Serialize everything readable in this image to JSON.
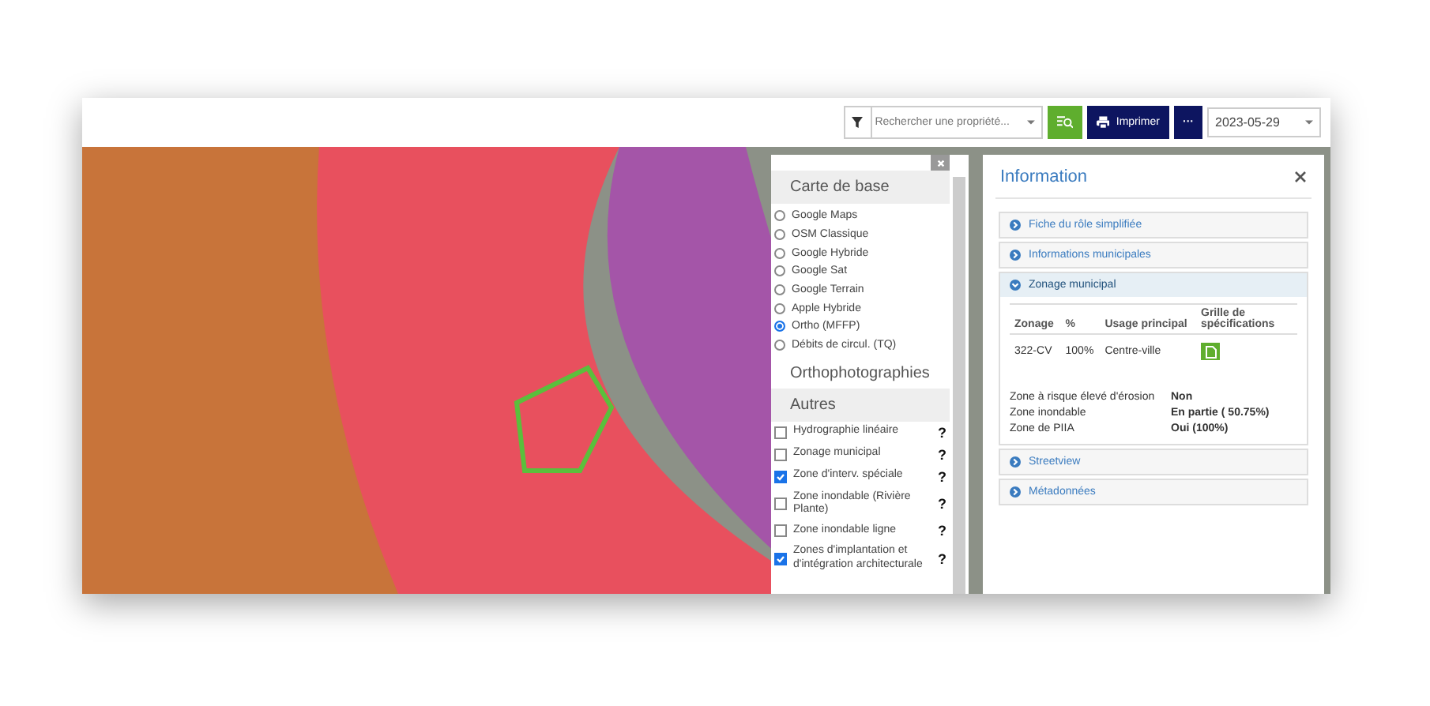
{
  "toolbar": {
    "search": {
      "placeholder": "Rechercher une propriété..."
    },
    "print_button": "Imprimer",
    "more_button": "···",
    "date": {
      "value": "2023-05-29"
    }
  },
  "layers_panel": {
    "base_title": "Carte de base",
    "base_maps": [
      {
        "label": "Google Maps",
        "selected": false
      },
      {
        "label": "OSM Classique",
        "selected": false
      },
      {
        "label": "Google Hybride",
        "selected": false
      },
      {
        "label": "Google Sat",
        "selected": false
      },
      {
        "label": "Google Terrain",
        "selected": false
      },
      {
        "label": "Apple Hybride",
        "selected": false
      },
      {
        "label": "Ortho (MFFP)",
        "selected": true
      },
      {
        "label": "Débits de circul. (TQ)",
        "selected": false
      }
    ],
    "ortho_title": "Orthophotographies",
    "other_title": "Autres",
    "help": "?",
    "layers": [
      {
        "label": "Hydrographie linéaire",
        "checked": false
      },
      {
        "label": "Zonage municipal",
        "checked": false
      },
      {
        "label": "Zone d'interv. spéciale",
        "checked": true
      },
      {
        "label": "Zone inondable (Rivière Plante)",
        "checked": false
      },
      {
        "label": "Zone inondable ligne",
        "checked": false
      },
      {
        "label": "Zones d'implantation et d'intégration architecturale",
        "checked": true
      }
    ]
  },
  "info_panel": {
    "title": "Information",
    "sections": [
      {
        "title": "Fiche du rôle simplifiée",
        "expanded": false
      },
      {
        "title": "Informations municipales",
        "expanded": false
      },
      {
        "title": "Zonage municipal",
        "expanded": true
      },
      {
        "title": "Streetview",
        "expanded": false
      },
      {
        "title": "Métadonnées",
        "expanded": false
      }
    ],
    "zoning_table": {
      "columns": [
        "Zonage",
        "%",
        "Usage principal",
        "Grille de spécifications"
      ],
      "rows": [
        {
          "zone": "322-CV",
          "percent": "100%",
          "usage": "Centre-ville"
        }
      ]
    },
    "properties": [
      {
        "label": "Zone à risque élevé d'érosion",
        "value": "Non"
      },
      {
        "label": "Zone inondable",
        "value": "En partie ( 50.75%)"
      },
      {
        "label": "Zone de PIIA",
        "value": "Oui (100%)"
      }
    ]
  }
}
